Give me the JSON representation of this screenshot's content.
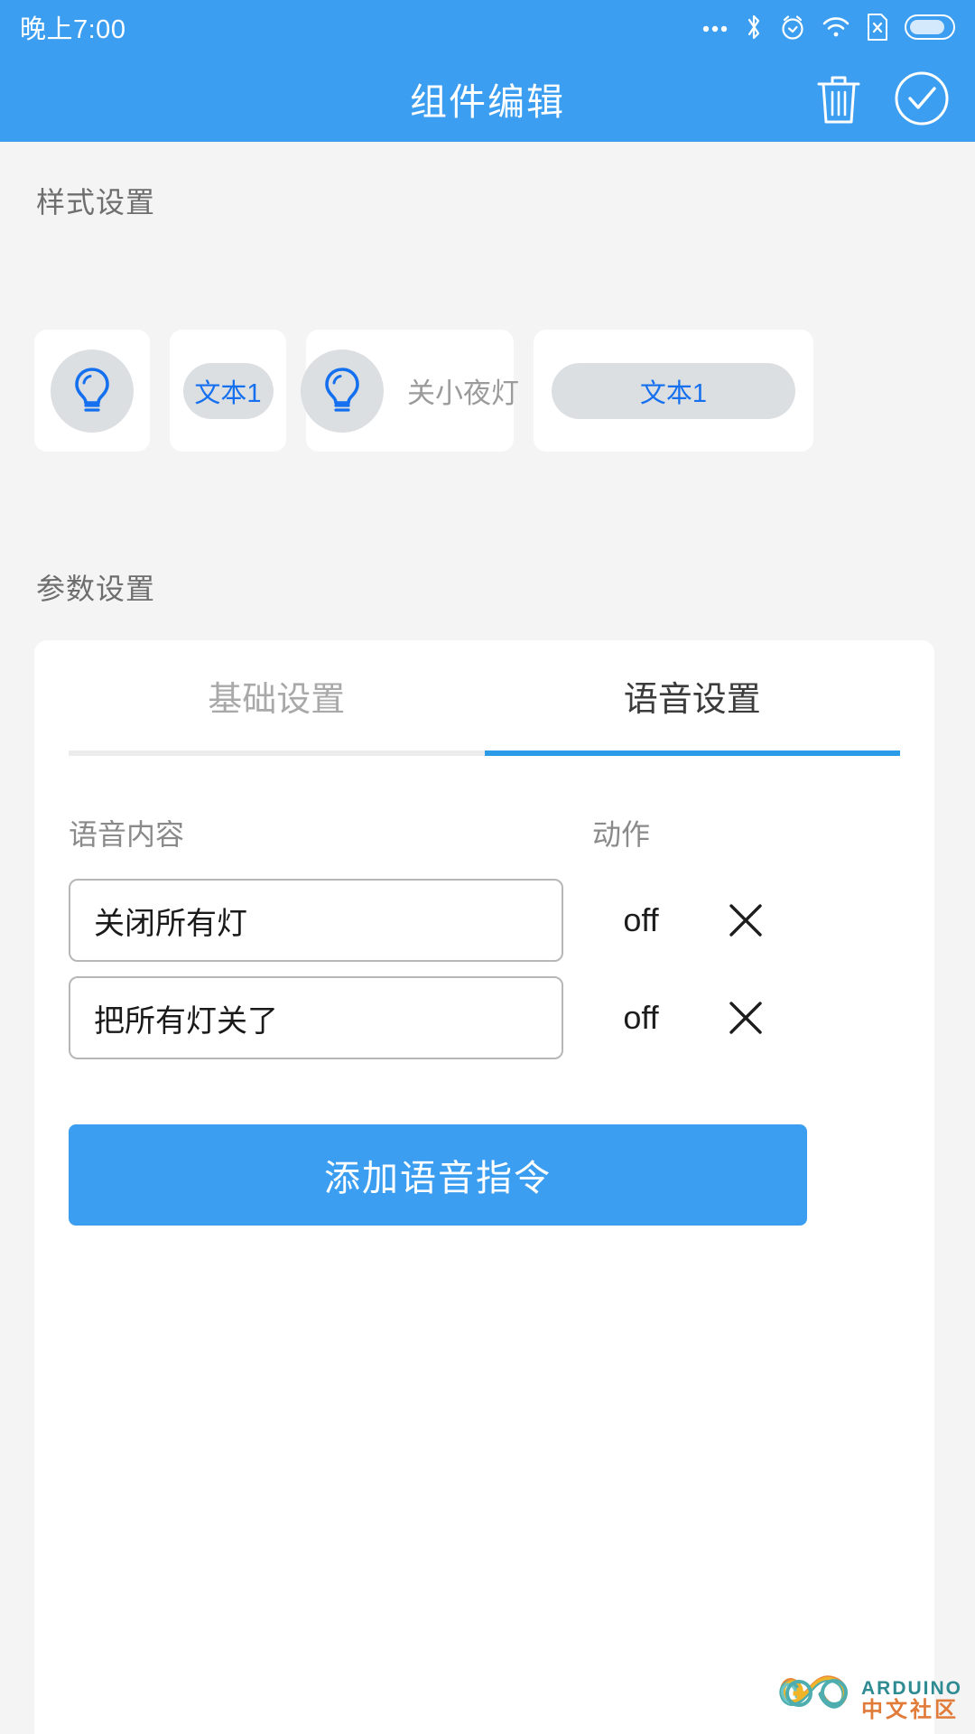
{
  "statusbar": {
    "time": "晚上7:00",
    "icons": [
      "more-dots-icon",
      "bluetooth-icon",
      "alarm-icon",
      "wifi-icon",
      "sim-card-off-icon",
      "battery-icon"
    ]
  },
  "appbar": {
    "title": "组件编辑",
    "delete_icon": "trash-icon",
    "confirm_icon": "check-circle-icon"
  },
  "style_section": {
    "title": "样式设置",
    "cards": [
      {
        "type": "icon",
        "icon": "lightbulb-icon",
        "label": ""
      },
      {
        "type": "pill",
        "icon": "",
        "label": "文本1"
      },
      {
        "type": "icon-text",
        "icon": "lightbulb-icon",
        "label": "关小夜灯"
      },
      {
        "type": "wide-pill",
        "icon": "",
        "label": "文本1"
      }
    ]
  },
  "param_section": {
    "title": "参数设置",
    "tabs": [
      {
        "label": "基础设置",
        "active": false
      },
      {
        "label": "语音设置",
        "active": true
      }
    ],
    "table": {
      "headers": [
        "语音内容",
        "动作"
      ],
      "rows": [
        {
          "voice": "关闭所有灯",
          "action": "off",
          "delete_icon": "close-x-icon"
        },
        {
          "voice": "把所有灯关了",
          "action": "off",
          "delete_icon": "close-x-icon"
        }
      ]
    },
    "add_button": "添加语音指令"
  },
  "watermark": {
    "en": "ARDUINO",
    "cn": "中文社区"
  },
  "colors": {
    "accent": "#3c9ef0",
    "tab_indicator": "#2b9ae8",
    "icon_blue": "#1570ef",
    "page_bg": "#f4f4f4"
  }
}
